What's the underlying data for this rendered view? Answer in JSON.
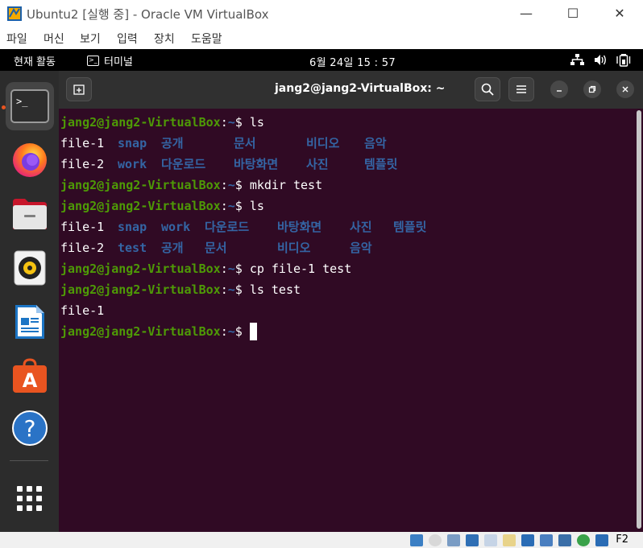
{
  "host": {
    "title": "Ubuntu2 [실행 중] - Oracle VM VirtualBox",
    "menu": [
      "파일",
      "머신",
      "보기",
      "입력",
      "장치",
      "도움말"
    ],
    "controls": {
      "minimize": "—",
      "maximize": "☐",
      "close": "✕"
    },
    "status_key": "F2"
  },
  "topbar": {
    "activities": "현재 활동",
    "app_name": "터미널",
    "clock": "6월 24일  15 : 57"
  },
  "dock": {
    "items": [
      "terminal-icon",
      "firefox-icon",
      "files-icon",
      "rhythmbox-icon",
      "libreoffice-writer-icon",
      "software-icon",
      "help-icon",
      "show-apps-icon"
    ],
    "help_glyph": "?",
    "software_glyph": "A",
    "terminal_glyph": ">_"
  },
  "terminal": {
    "title": "jang2@jang2-VirtualBox: ~",
    "prompt_user": "jang2@jang2-VirtualBox",
    "prompt_colon": ":",
    "prompt_path": "~",
    "prompt_dollar": "$ ",
    "commands": {
      "c1": "ls",
      "c2": "mkdir test",
      "c3": "ls",
      "c4": "cp file-1 test",
      "c5": "ls test"
    },
    "out1": {
      "file1": "file-1",
      "file2": "file-2",
      "dirs1": [
        "snap",
        "공개",
        "문서",
        "비디오",
        "음악"
      ],
      "dirs2": [
        "work",
        "다운로드",
        "바탕화면",
        "사진",
        "템플릿"
      ]
    },
    "out2": {
      "file1": "file-1",
      "file2": "file-2",
      "dirs1": [
        "snap",
        "work",
        "다운로드",
        "바탕화면",
        "사진",
        "템플릿"
      ],
      "dirs2": [
        "test",
        "공개",
        "문서",
        "비디오",
        "음악"
      ]
    },
    "out3": "file-1"
  }
}
